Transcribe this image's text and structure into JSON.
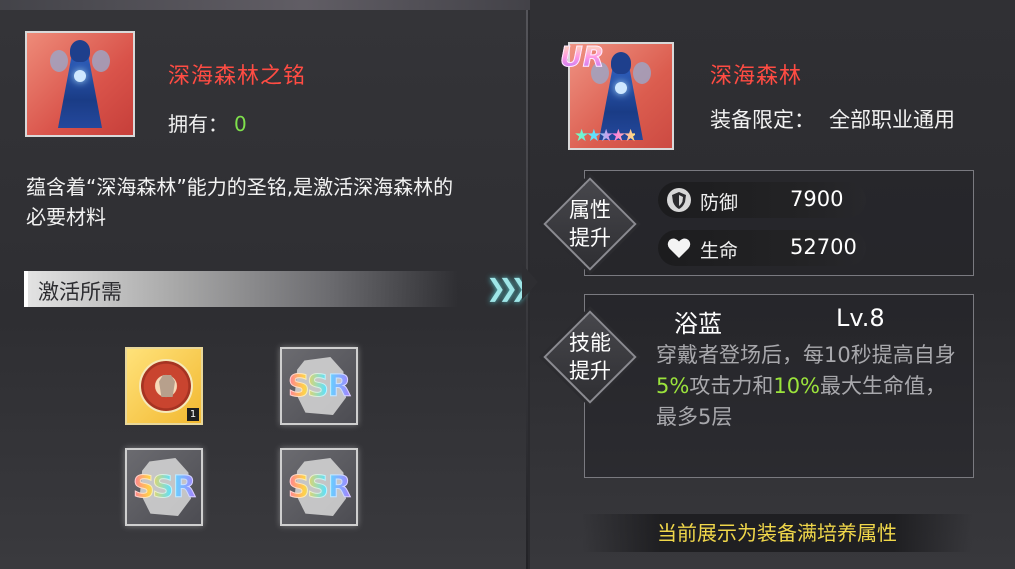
{
  "material": {
    "name": "深海森林之铭",
    "owned_label": "拥有：",
    "owned_count": "0",
    "description": "蕴含着“深海森林”能力的圣铭,是激活深海森林的必要材料",
    "image": "deep-sea-forest-figure-icon"
  },
  "requirements": {
    "title": "激活所需",
    "slots": [
      {
        "type": "medal",
        "icon": "armor-medal-icon",
        "quantity": "1"
      },
      {
        "type": "ssr",
        "label": "SSR"
      },
      {
        "type": "ssr",
        "label": "SSR"
      },
      {
        "type": "ssr",
        "label": "SSR"
      }
    ]
  },
  "equipment": {
    "rarity": "UR",
    "stars": "★★★★★",
    "name": "深海森林",
    "limit_label": "装备限定：",
    "limit_value": "全部职业通用"
  },
  "attributes": {
    "section_label_1": "属性",
    "section_label_2": "提升",
    "stats": [
      {
        "icon": "shield-icon",
        "name": "防御",
        "value": "7900"
      },
      {
        "icon": "heart-icon",
        "name": "生命",
        "value": "52700"
      }
    ]
  },
  "skill": {
    "section_label_1": "技能",
    "section_label_2": "提升",
    "name": "浴蓝",
    "level": "Lv.8",
    "desc_part1": "穿戴者登场后，每10秒提高自身",
    "desc_hl1": "5%",
    "desc_part2": "攻击力和",
    "desc_hl2": "10%",
    "desc_part3": "最大生命值，最多5层"
  },
  "footer_note": "当前展示为装备满培养属性",
  "colors": {
    "name_red": "#ff4c43",
    "owned_green": "#7fe04c",
    "highlight_green": "#9be33c",
    "footer_gold": "#f0d74a"
  }
}
